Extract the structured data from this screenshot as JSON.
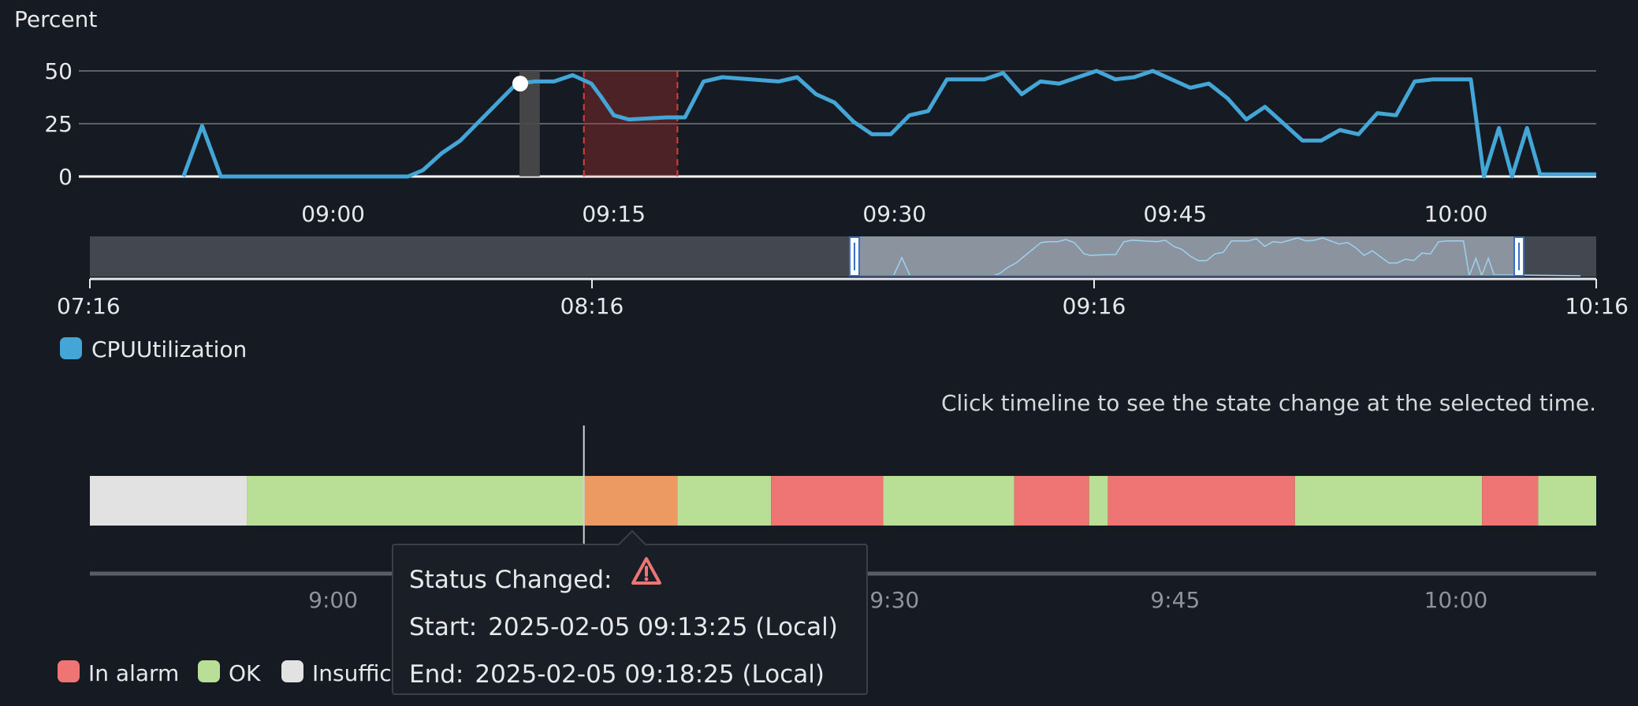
{
  "chart_data": [
    {
      "type": "line",
      "ylabel": "Percent",
      "yticks": [
        0,
        25,
        50
      ],
      "ylim": [
        0,
        50
      ],
      "xticks": [
        "09:00",
        "09:15",
        "09:30",
        "09:45",
        "10:00"
      ],
      "xtick_minutes": [
        0,
        15,
        30,
        45,
        60
      ],
      "xlim_minutes": [
        -13,
        67.5
      ],
      "series": [
        {
          "name": "CPUUtilization",
          "color": "#43a6d6",
          "x_minutes": [
            -8.0,
            -7.0,
            -6.0,
            -5.0,
            -4.0,
            -3.0,
            -2.0,
            -1.0,
            0.0,
            1.0,
            2.0,
            3.0,
            4.0,
            4.8,
            5.8,
            6.8,
            7.8,
            8.8,
            9.8,
            10.8,
            11.8,
            12.8,
            13.8,
            14.3,
            15.0,
            15.8,
            17.8,
            18.8,
            19.8,
            20.8,
            23.8,
            24.8,
            25.8,
            26.8,
            27.8,
            28.8,
            29.8,
            30.8,
            31.8,
            32.8,
            33.8,
            34.8,
            35.8,
            36.8,
            37.8,
            38.8,
            39.8,
            40.8,
            41.8,
            42.8,
            43.8,
            44.8,
            45.8,
            46.8,
            47.8,
            48.8,
            49.8,
            50.8,
            51.8,
            52.8,
            53.8,
            54.8,
            55.8,
            56.8,
            57.8,
            58.8,
            59.8,
            60.8,
            61.5,
            62.3,
            63.0,
            63.8,
            64.5,
            67.5
          ],
          "values": [
            0,
            24,
            0,
            0,
            0,
            0,
            0,
            0,
            0,
            0,
            0,
            0,
            0,
            3,
            11,
            17,
            26,
            35,
            44,
            45,
            45,
            48,
            44,
            38,
            29,
            27,
            28,
            28,
            45,
            47,
            45,
            47,
            39,
            35,
            26,
            20,
            20,
            29,
            31,
            46,
            46,
            46,
            49,
            39,
            45,
            44,
            47,
            50,
            46,
            47,
            50,
            46,
            42,
            44,
            37,
            27,
            33,
            25,
            17,
            17,
            22,
            20,
            30,
            29,
            45,
            46,
            46,
            46,
            0,
            23,
            0,
            23,
            1,
            1
          ]
        }
      ],
      "markers": [
        {
          "type": "point",
          "x_minutes": 10.0,
          "value": 44
        },
        {
          "type": "band",
          "label": "selected",
          "x_minutes": [
            10.0,
            11.0
          ]
        },
        {
          "type": "alarm-window",
          "x_minutes": [
            13.4,
            18.4
          ]
        }
      ],
      "legend": [
        {
          "label": "CPUUtilization",
          "color": "#43a6d6"
        }
      ],
      "grid": true
    },
    {
      "type": "area",
      "role": "overview-navigator",
      "xticks": [
        "07:16",
        "08:16",
        "09:16",
        "10:16"
      ],
      "selection": "08:46 to 10:07"
    }
  ],
  "hint": "Click timeline to see the state change at the selected time.",
  "timeline": {
    "ticks": [
      "9:00",
      "9:15",
      "9:30",
      "9:45",
      "10:00"
    ],
    "tick_minutes": [
      0,
      15,
      30,
      45,
      60
    ],
    "segments": [
      {
        "state": "Insufficient data",
        "start": -13.0,
        "end": -4.6
      },
      {
        "state": "OK",
        "start": -4.6,
        "end": 13.4
      },
      {
        "state": "Warning",
        "start": 13.4,
        "end": 18.4
      },
      {
        "state": "OK",
        "start": 18.4,
        "end": 23.4
      },
      {
        "state": "In alarm",
        "start": 23.4,
        "end": 29.4
      },
      {
        "state": "OK",
        "start": 29.4,
        "end": 36.4
      },
      {
        "state": "In alarm",
        "start": 36.4,
        "end": 40.4
      },
      {
        "state": "OK",
        "start": 40.4,
        "end": 41.4
      },
      {
        "state": "In alarm",
        "start": 41.4,
        "end": 51.4
      },
      {
        "state": "OK",
        "start": 51.4,
        "end": 61.4
      },
      {
        "state": "In alarm",
        "start": 61.4,
        "end": 64.4
      },
      {
        "state": "OK",
        "start": 64.4,
        "end": 67.5
      }
    ],
    "cursor_minute": 13.4,
    "legend": [
      {
        "label": "In alarm",
        "color": "#ef7474"
      },
      {
        "label": "OK",
        "color": "#b9de96"
      },
      {
        "label": "Insuffic",
        "color": "#e2e2e2"
      }
    ]
  },
  "tooltip": {
    "status_label": "Status Changed:",
    "status_icon": "warning-triangle-icon",
    "start_label": "Start:",
    "start_value": "2025-02-05 09:13:25 (Local)",
    "end_label": "End:",
    "end_value": "2025-02-05 09:18:25 (Local)"
  },
  "colors": {
    "background": "#161b23",
    "ok": "#b9de96",
    "alarm": "#ef7474",
    "warning": "#ec9a62",
    "insufficient": "#e2e2e2",
    "line": "#43a6d6"
  }
}
